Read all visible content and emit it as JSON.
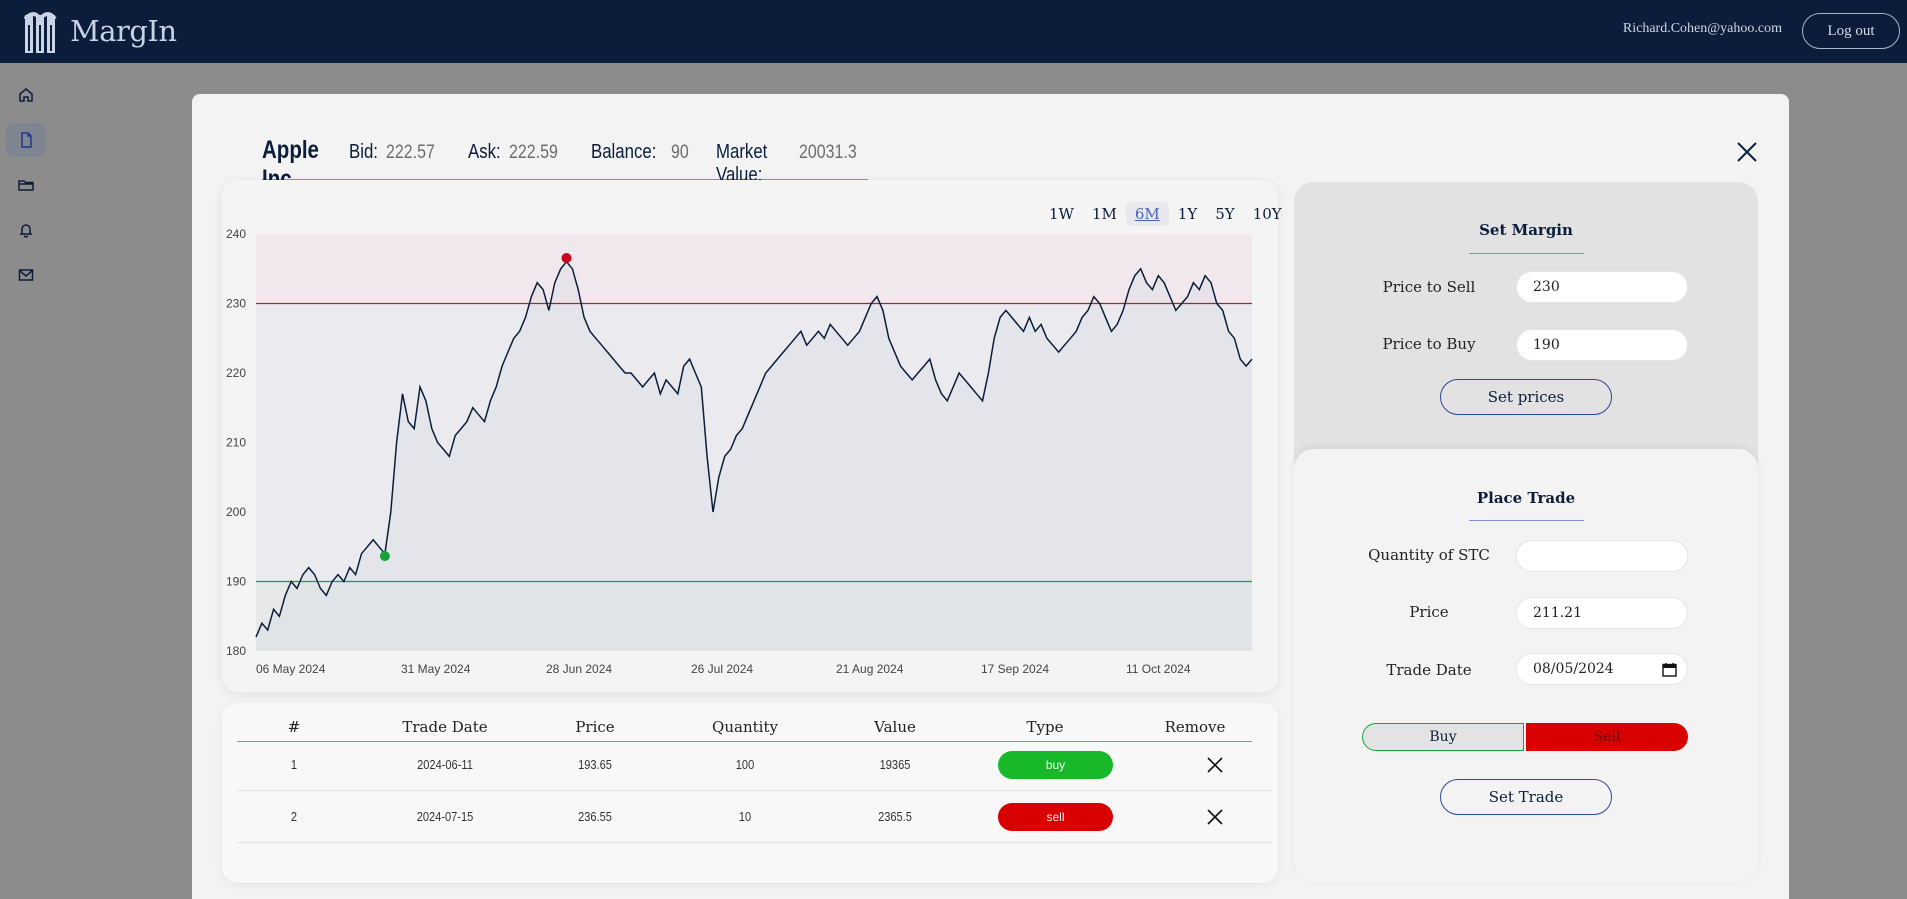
{
  "app": {
    "name": "MargIn",
    "user_email": "Richard.Cohen@yahoo.com",
    "logout_label": "Log out"
  },
  "sidebar": {
    "items": [
      {
        "icon": "home-icon",
        "active": false
      },
      {
        "icon": "document-icon",
        "active": true
      },
      {
        "icon": "folder-icon",
        "active": false
      },
      {
        "icon": "bell-icon",
        "active": false
      },
      {
        "icon": "mail-icon",
        "active": false
      }
    ]
  },
  "stock": {
    "name": "Apple Inc",
    "bid_label": "Bid:",
    "bid": "222.57",
    "ask_label": "Ask:",
    "ask": "222.59",
    "balance_label": "Balance:",
    "balance": "90",
    "market_value_label": "Market Value:",
    "market_value": "20031.3"
  },
  "ranges": [
    "1W",
    "1M",
    "6M",
    "1Y",
    "5Y",
    "10Y"
  ],
  "active_range": "6M",
  "chart_data": {
    "type": "line",
    "x_tick_labels": [
      "06 May 2024",
      "31 May 2024",
      "28 Jun 2024",
      "26 Jul 2024",
      "21 Aug 2024",
      "17 Sep 2024",
      "11 Oct 2024"
    ],
    "ylim": [
      180,
      240
    ],
    "y_ticks": [
      180,
      190,
      200,
      210,
      220,
      230,
      240
    ],
    "sell_level": 230,
    "buy_level": 190,
    "series": [
      {
        "values": [
          182,
          184,
          183,
          186,
          185,
          188,
          190,
          189,
          191,
          192,
          191,
          189,
          188,
          190,
          191,
          190,
          192,
          191,
          194,
          195,
          196,
          195,
          194,
          200,
          210,
          217,
          213,
          212,
          218,
          216,
          212,
          210,
          209,
          208,
          211,
          212,
          213,
          215,
          214,
          213,
          216,
          218,
          221,
          223,
          225,
          226,
          228,
          231,
          233,
          232,
          229,
          233,
          235,
          236,
          235,
          232,
          228,
          226,
          225,
          224,
          223,
          222,
          221,
          220,
          220,
          219,
          218,
          219,
          220,
          217,
          219,
          218,
          217,
          221,
          222,
          220,
          218,
          208,
          200,
          205,
          208,
          209,
          211,
          212,
          214,
          216,
          218,
          220,
          221,
          222,
          223,
          224,
          225,
          226,
          224,
          225,
          226,
          225,
          227,
          226,
          225,
          224,
          225,
          226,
          228,
          230,
          231,
          229,
          225,
          223,
          221,
          220,
          219,
          220,
          221,
          222,
          219,
          217,
          216,
          218,
          220,
          219,
          218,
          217,
          216,
          220,
          225,
          228,
          229,
          228,
          227,
          226,
          228,
          226,
          227,
          225,
          224,
          223,
          224,
          225,
          226,
          228,
          229,
          231,
          230,
          228,
          226,
          227,
          229,
          232,
          234,
          235,
          233,
          232,
          234,
          233,
          231,
          229,
          230,
          231,
          233,
          232,
          234,
          233,
          230,
          229,
          226,
          225,
          222,
          221,
          222
        ],
        "markers": [
          {
            "index": 22,
            "value": 193.65,
            "type": "buy",
            "color": "#17a33a"
          },
          {
            "index": 53,
            "value": 236.55,
            "type": "sell",
            "color": "#c8001c"
          }
        ]
      }
    ]
  },
  "trades": {
    "headers": [
      "#",
      "Trade Date",
      "Price",
      "Quantity",
      "Value",
      "Type",
      "Remove"
    ],
    "rows": [
      {
        "num": "1",
        "date": "2024-06-11",
        "price": "193.65",
        "quantity": "100",
        "value": "19365",
        "type": "buy"
      },
      {
        "num": "2",
        "date": "2024-07-15",
        "price": "236.55",
        "quantity": "10",
        "value": "2365.5",
        "type": "sell"
      }
    ]
  },
  "set_margin": {
    "title": "Set Margin",
    "sell_label": "Price to Sell",
    "sell_value": "230",
    "buy_label": "Price to Buy",
    "buy_value": "190",
    "button": "Set prices"
  },
  "place_trade": {
    "title": "Place Trade",
    "quantity_label": "Quantity of STC",
    "quantity_value": "",
    "price_label": "Price",
    "price_value": "211.21",
    "date_label": "Trade Date",
    "date_value": "08/05/2024",
    "buy_label": "Buy",
    "sell_label": "Sell",
    "button": "Set Trade"
  },
  "colors": {
    "navy": "#0b1d3a",
    "buy_green": "#17a33a",
    "sell_red": "#d90000",
    "accent_blue": "#4a63b8"
  }
}
